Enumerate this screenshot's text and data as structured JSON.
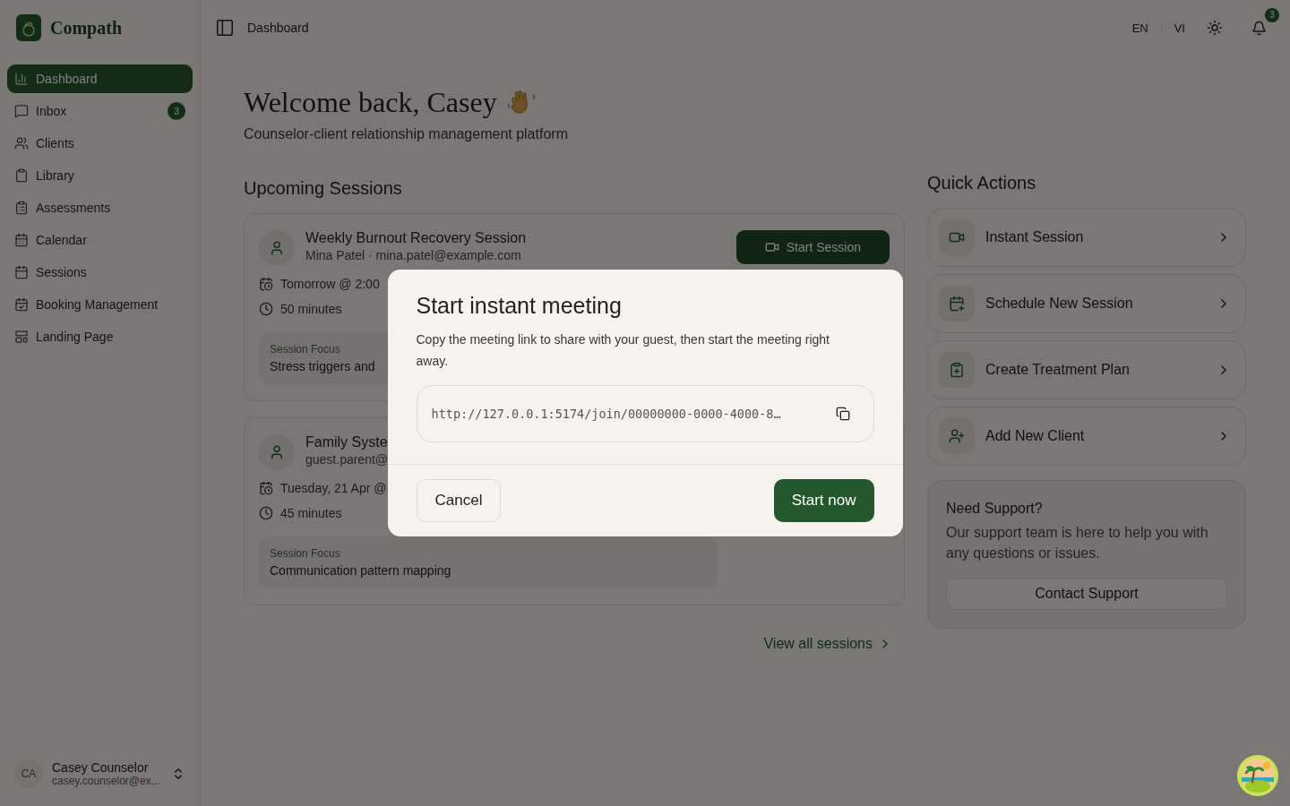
{
  "brand": {
    "name": "Compath"
  },
  "sidebar": {
    "items": [
      {
        "label": "Dashboard",
        "selected": true
      },
      {
        "label": "Inbox",
        "selected": false,
        "badge": "3"
      },
      {
        "label": "Clients",
        "selected": false
      },
      {
        "label": "Library",
        "selected": false
      },
      {
        "label": "Assessments",
        "selected": false
      },
      {
        "label": "Calendar",
        "selected": false
      },
      {
        "label": "Sessions",
        "selected": false
      },
      {
        "label": "Booking Management",
        "selected": false
      },
      {
        "label": "Landing Page",
        "selected": false
      }
    ],
    "user": {
      "initials": "CA",
      "name": "Casey Counselor",
      "email": "casey.counselor@ex..."
    }
  },
  "header": {
    "breadcrumb": "Dashboard",
    "languages": [
      "EN",
      "VI"
    ],
    "notification_count": "3"
  },
  "welcome": {
    "title": "Welcome back, Casey",
    "subtitle": "Counselor-client relationship management platform"
  },
  "upcoming": {
    "heading": "Upcoming Sessions",
    "sessions": [
      {
        "title": "Weekly Burnout Recovery Session",
        "client": "Mina Patel · mina.patel@example.com",
        "when": "Tomorrow @ 2:00",
        "duration": "50 minutes",
        "focus_label": "Session Focus",
        "focus": "Stress triggers and",
        "action": "Start Session"
      },
      {
        "title": "Family Syste",
        "client": "guest.parent@",
        "when": "Tuesday, 21 Apr @",
        "duration": "45 minutes",
        "focus_label": "Session Focus",
        "focus": "Communication pattern mapping"
      }
    ],
    "view_all": "View all sessions"
  },
  "quick_actions": {
    "heading": "Quick Actions",
    "items": [
      {
        "label": "Instant Session"
      },
      {
        "label": "Schedule New Session"
      },
      {
        "label": "Create Treatment Plan"
      },
      {
        "label": "Add New Client"
      }
    ]
  },
  "support": {
    "title": "Need Support?",
    "text": "Our support team is here to help you with any questions or issues.",
    "button": "Contact Support"
  },
  "dialog": {
    "title": "Start instant meeting",
    "text": "Copy the meeting link to share with your guest, then start the meeting right away.",
    "link": "http://127.0.0.1:5174/join/00000000-0000-4000-8…",
    "cancel": "Cancel",
    "confirm": "Start now"
  }
}
